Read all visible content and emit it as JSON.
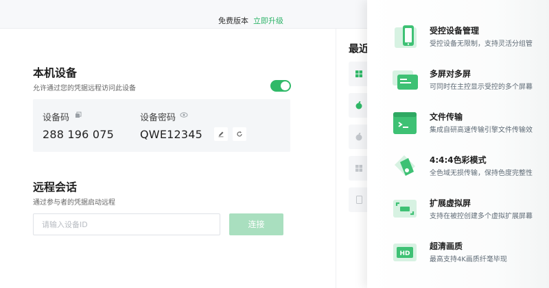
{
  "topbar": {
    "version": "免费版本",
    "upgrade": "立即升级"
  },
  "local_device": {
    "title": "本机设备",
    "subtitle": "允许通过您的凭据远程访问此设备",
    "toggle_on": true,
    "device_code_label": "设备码",
    "device_code": "288 196 075",
    "password_label": "设备密码",
    "password": "QWE12345"
  },
  "remote_session": {
    "title": "远程会话",
    "subtitle": "通过参与者的凭据启动远程",
    "input_placeholder": "请输入设备ID",
    "connect_label": "连接"
  },
  "recent": {
    "title": "最近",
    "items": [
      {
        "icon": "windows-icon"
      },
      {
        "icon": "apple-icon"
      },
      {
        "icon": "apple-icon"
      },
      {
        "icon": "windows-icon"
      },
      {
        "icon": "tablet-icon"
      }
    ]
  },
  "features": [
    {
      "icon": "tablet-device-icon",
      "title": "受控设备管理",
      "desc": "受控设备无限制，支持灵活分组管"
    },
    {
      "icon": "multi-screen-icon",
      "title": "多屏对多屏",
      "desc": "可同时在主控显示受控的多个屏幕"
    },
    {
      "icon": "terminal-icon",
      "title": "文件传输",
      "desc": "集成自研高速传输引擎文件传输效"
    },
    {
      "icon": "color-palette-icon",
      "title": "4:4:4色彩模式",
      "desc": "全色域无损传输，保持色度完整性"
    },
    {
      "icon": "virtual-screen-icon",
      "title": "扩展虚拟屏",
      "desc": "支持在被控创建多个虚拟扩展屏幕"
    },
    {
      "icon": "hd-icon",
      "title": "超清画质",
      "desc": "最高支持4K画质纤毫毕现"
    }
  ],
  "colors": {
    "accent": "#30b968",
    "connect_disabled": "#a9dfbf"
  }
}
